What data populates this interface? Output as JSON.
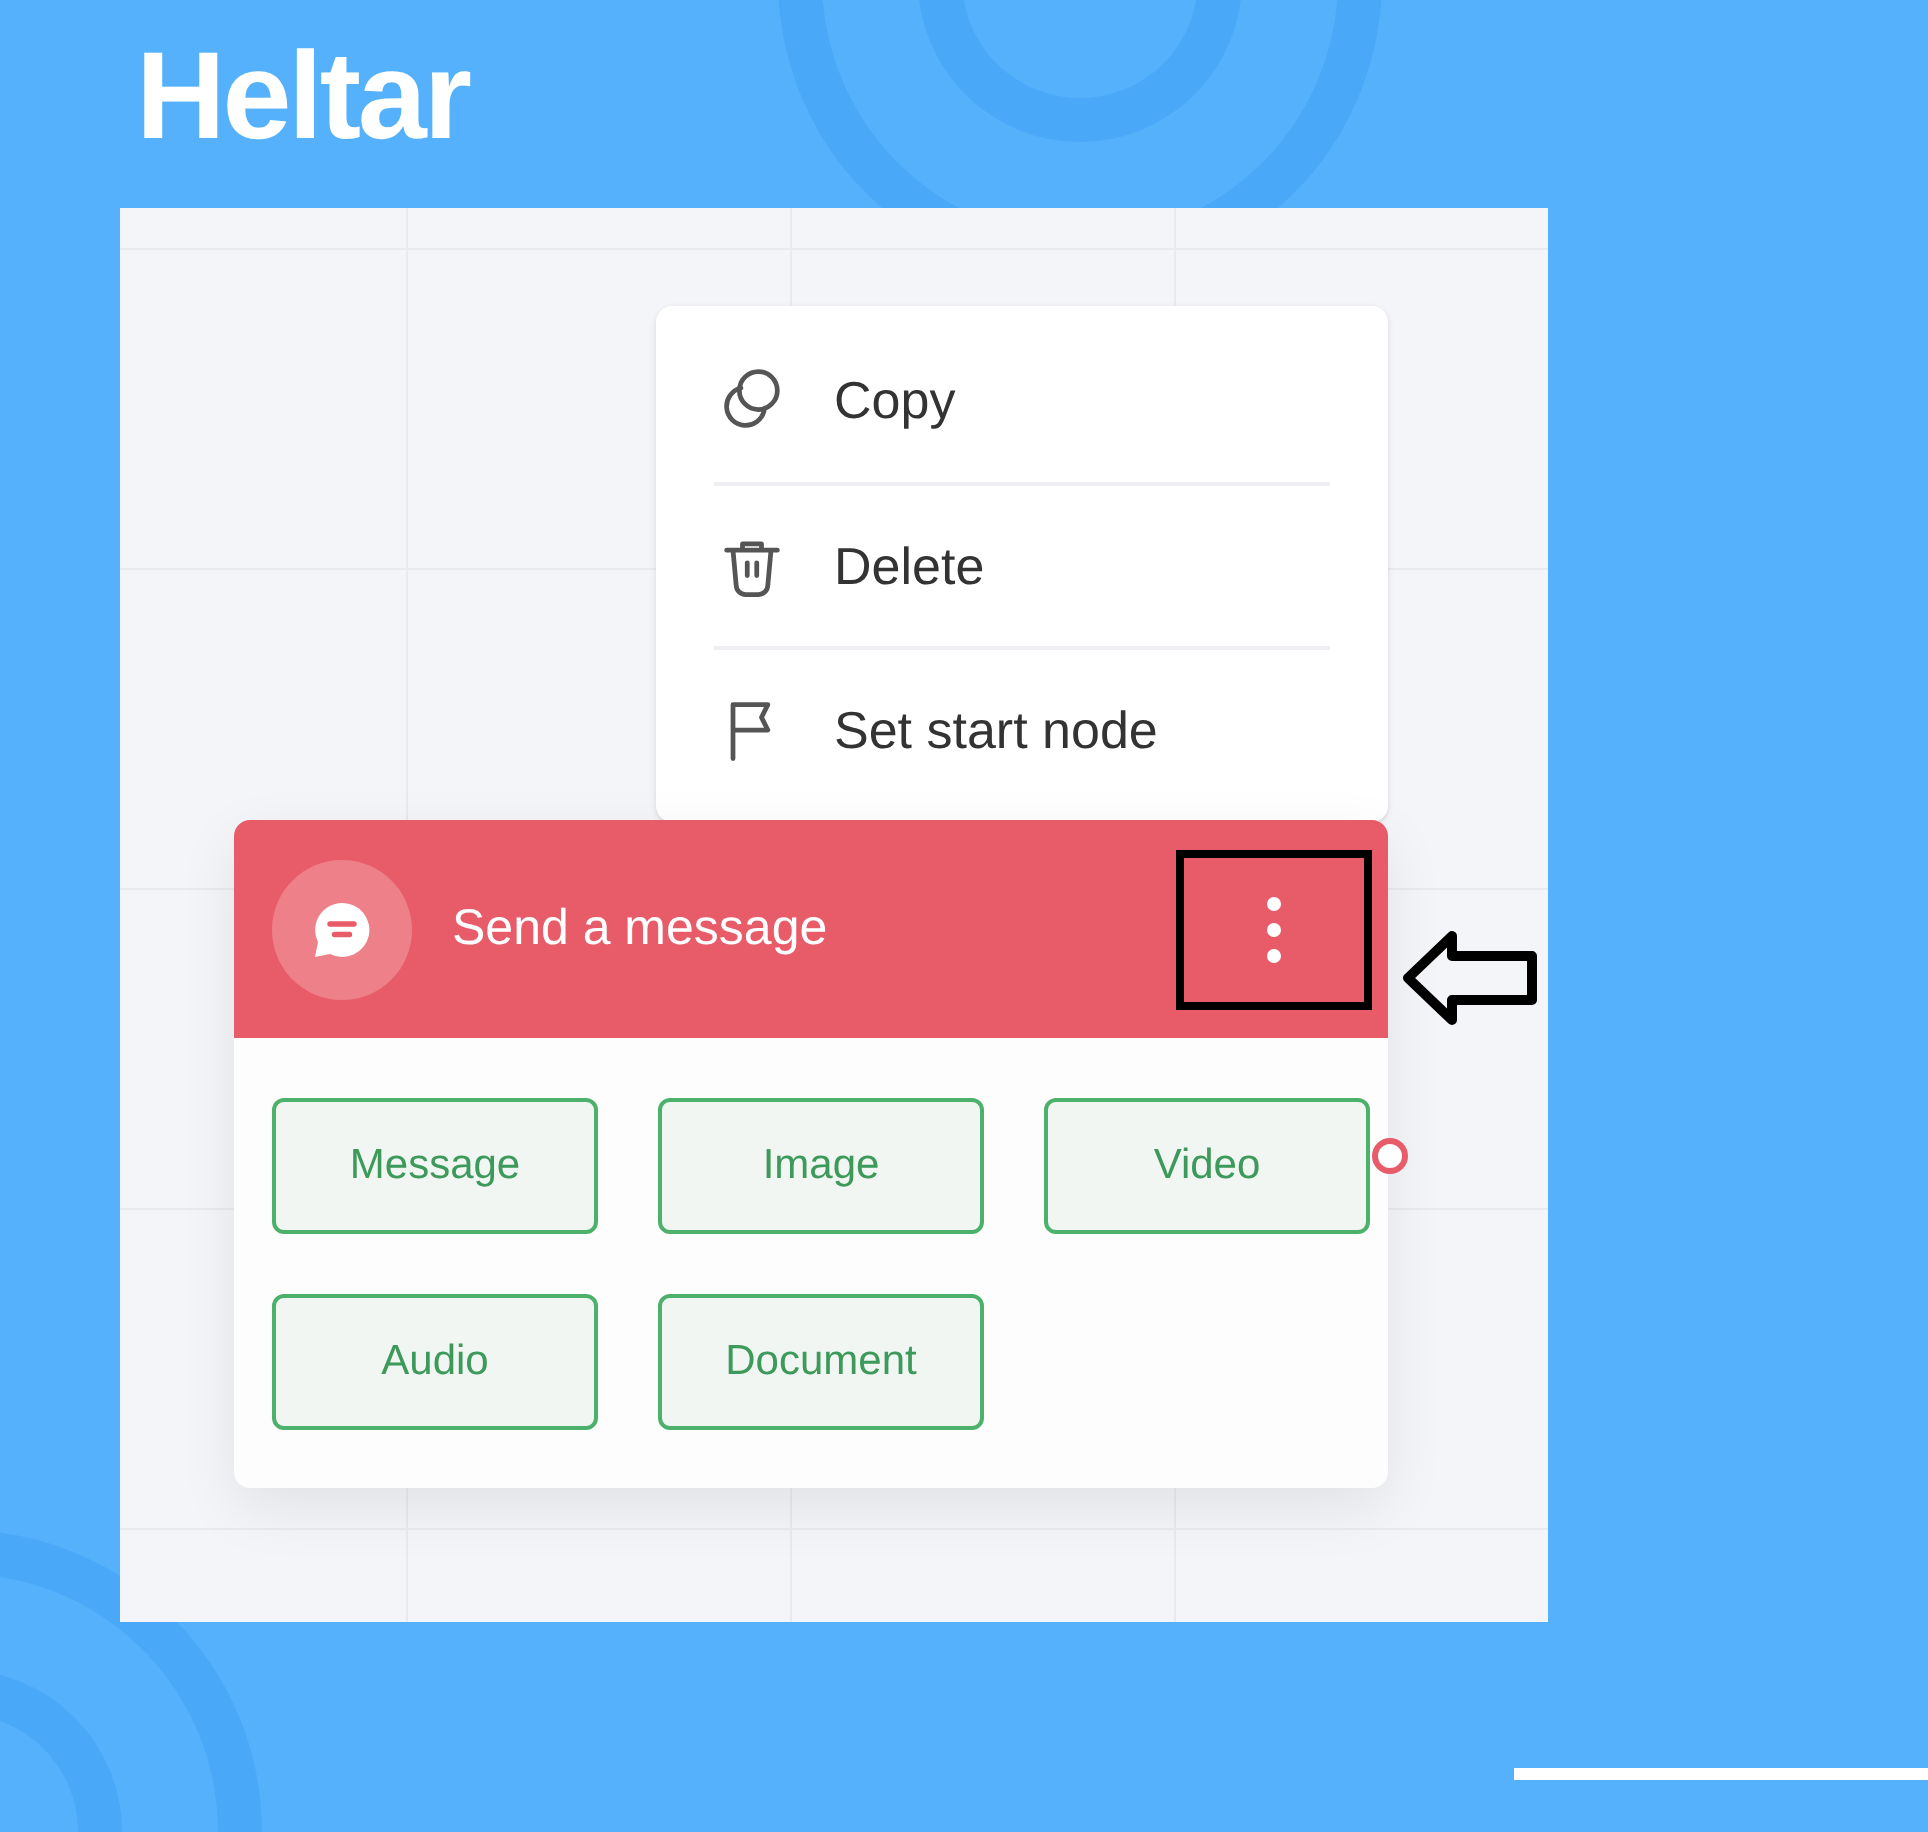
{
  "logo": "Heltar",
  "context_menu": {
    "items": [
      {
        "label": "Copy"
      },
      {
        "label": "Delete"
      },
      {
        "label": "Set start node"
      }
    ]
  },
  "node": {
    "title": "Send a message",
    "options": [
      {
        "label": "Message"
      },
      {
        "label": "Image"
      },
      {
        "label": "Video"
      },
      {
        "label": "Audio"
      },
      {
        "label": "Document"
      }
    ]
  }
}
